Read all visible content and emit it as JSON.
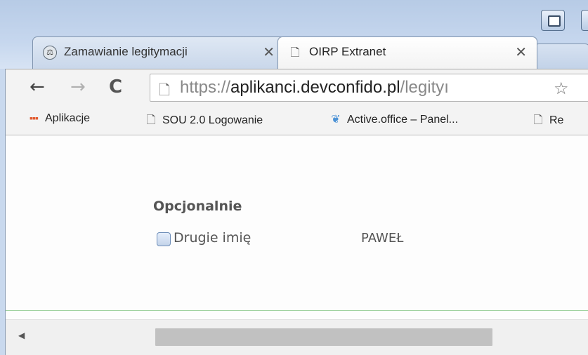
{
  "tabs": [
    {
      "title": "Zamawianie legitymacji",
      "favicon": "seal-icon",
      "active": false
    },
    {
      "title": "OIRP Extranet",
      "favicon": "page-icon",
      "active": true
    }
  ],
  "toolbar": {
    "url_scheme": "https://",
    "url_host": "aplikanci.devconfido.pl",
    "url_path": "/legityı"
  },
  "bookmarks": [
    {
      "label": "Aplikacje",
      "icon": "apps-grid-icon"
    },
    {
      "label": "SOU 2.0 Logowanie",
      "icon": "page-icon"
    },
    {
      "label": "Active.office – Panel...",
      "icon": "leaf-icon"
    },
    {
      "label": "Re",
      "icon": "page-icon"
    }
  ],
  "content": {
    "section_title": "Opcjonalnie",
    "checkbox_label": "Drugie imię",
    "checkbox_checked": false,
    "value": "PAWEŁ"
  },
  "colors": {
    "accent_line": "#9fd19f",
    "frame": "#c9d9ee"
  }
}
